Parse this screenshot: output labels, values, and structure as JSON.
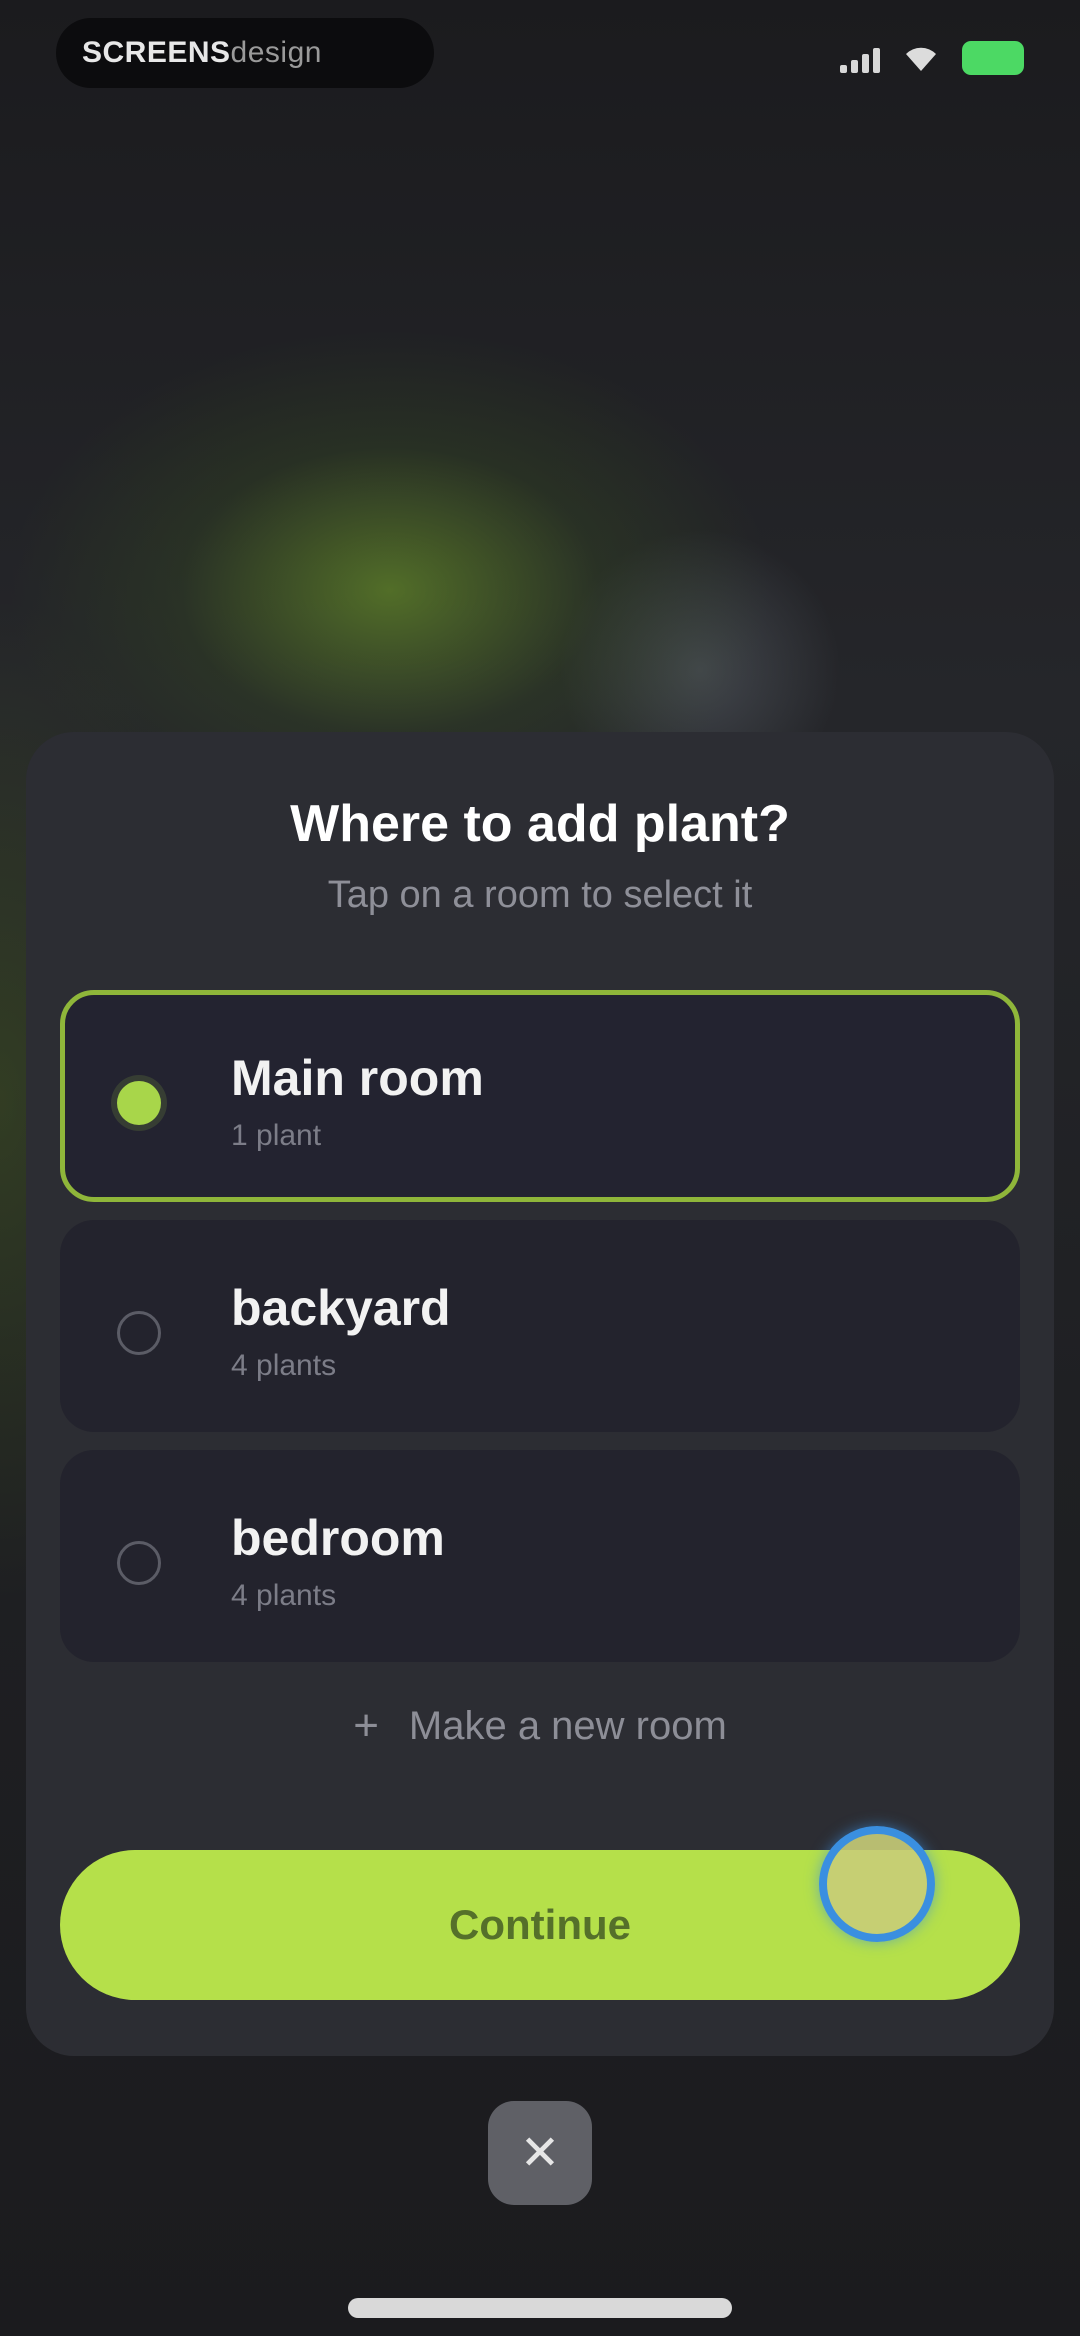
{
  "status_bar": {
    "app_label_bold": "SCREENS",
    "app_label_light": "design",
    "signal_icon": "cellular-signal-icon",
    "wifi_icon": "wifi-icon",
    "battery_icon": "battery-icon",
    "battery_color": "#4cd964"
  },
  "background": {
    "heading_words": [
      "",
      ""
    ]
  },
  "sheet": {
    "title": "Where to add plant?",
    "subtitle": "Tap on a room to select it",
    "rooms": [
      {
        "name": "Main room",
        "count": "1 plant",
        "selected": true
      },
      {
        "name": "backyard",
        "count": "4 plants",
        "selected": false
      },
      {
        "name": "bedroom",
        "count": "4 plants",
        "selected": false
      }
    ],
    "new_room_label": "Make a new room",
    "continue_label": "Continue"
  },
  "colors": {
    "accent": "#b5e04a",
    "selected_border": "#8fb63a",
    "sheet_bg": "#2c2d33",
    "card_bg": "#23232d"
  },
  "icons": {
    "plus": "plus-icon",
    "close": "close-icon"
  }
}
